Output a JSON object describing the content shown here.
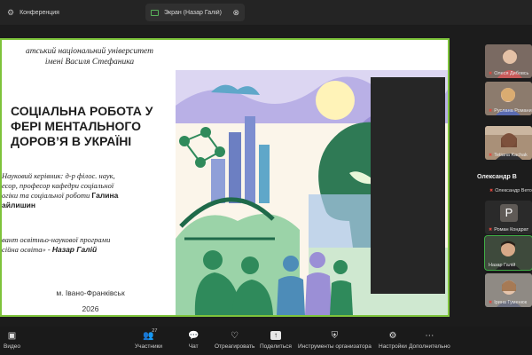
{
  "tabs": [
    {
      "label": "Конференция",
      "icon": "gear-icon"
    },
    {
      "label": "Экран (Назар Галій)",
      "icon": "screen-share-icon"
    }
  ],
  "slide": {
    "university_line1": "атський національний університет",
    "university_line2": "імені Василя Стефаника",
    "title_line1": "СОЦІАЛЬНА РОБОТА У",
    "title_line2": "ФЕРІ МЕНТАЛЬНОГО",
    "title_line3": "ДОРОВ’Я В УКРАЇНІ",
    "supervisor_text_line1": "Науковий керівник: д-р філос. наук,",
    "supervisor_text_line2": "есор, професор кафедри соціальної",
    "supervisor_text_line3": "огіки та соціальної роботи",
    "supervisor_name_a": "Галина",
    "supervisor_name_b": "айлишин",
    "candidate_line1": "вант освітньо-наукової програми",
    "candidate_program": "сійна освіта» -",
    "candidate_name": "Назар Галій",
    "city": "м. Івано-Франківськ",
    "year": "2026"
  },
  "participants": {
    "tiles": [
      {
        "name": "Олеся Дибовсь"
      },
      {
        "name": "Руслана Романи"
      },
      {
        "name": "Tetiana Kachak"
      }
    ],
    "name_only": "Олександр В",
    "name_only_row": "Олександр Вето",
    "avatar_letter": "Р",
    "avatar_name": "Роман Кондрат",
    "active_name": "Назар Галій",
    "last_tile_name": "Ірина Гуменюк"
  },
  "toolbar": {
    "video": "Видео",
    "participants": "Участники",
    "participants_count": "27",
    "chat": "Чат",
    "react": "Отреагировать",
    "share": "Поделиться",
    "host_tools": "Инструменты организатора",
    "settings": "Настройки",
    "more": "Дополнительно"
  },
  "colors": {
    "accent_green": "#7ec33b",
    "active_green": "#3fae45",
    "mic_off_red": "#e0483e",
    "illustration_green": "#2f8a5b",
    "illustration_purple": "#9b8fd6",
    "illustration_blue": "#5fa7c9"
  }
}
